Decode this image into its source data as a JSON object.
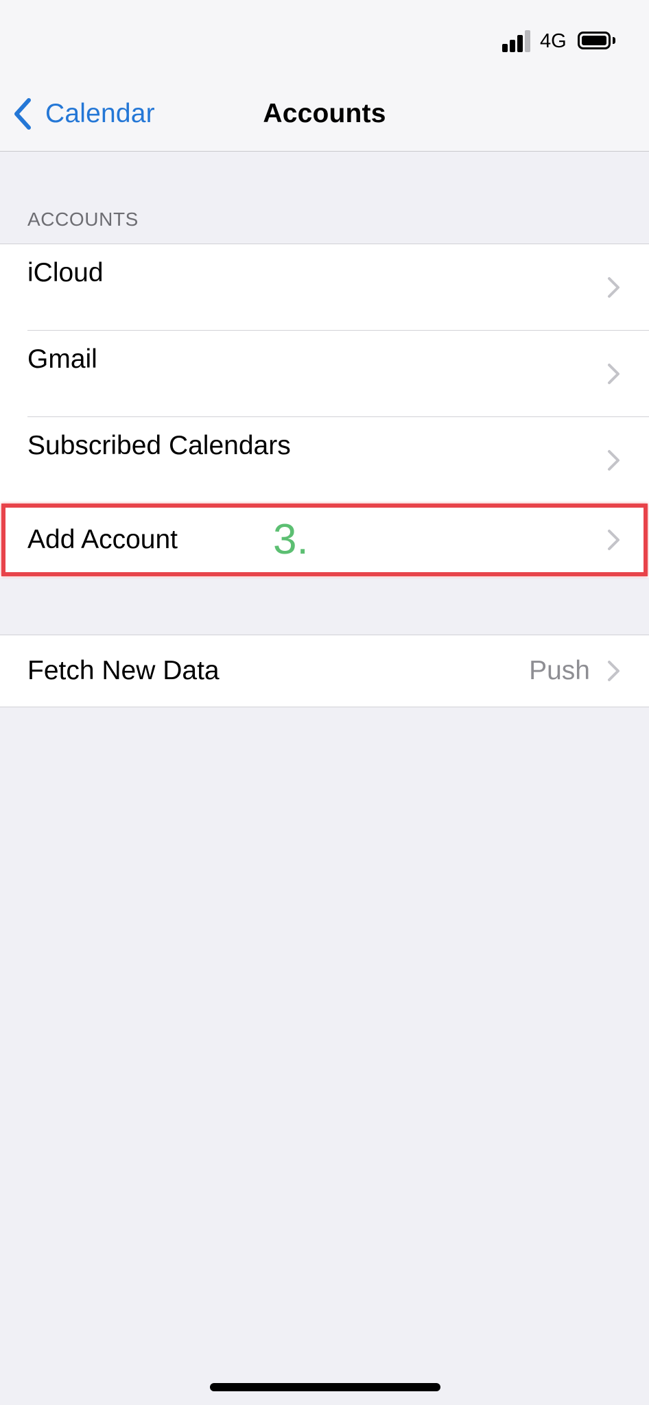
{
  "status_bar": {
    "network": "4G",
    "icons": [
      "signal-icon",
      "battery-icon"
    ]
  },
  "nav": {
    "back_label": "Calendar",
    "title": "Accounts",
    "back_icon": "chevron-left-icon",
    "accent_color": "#2477d6"
  },
  "accounts_section": {
    "header": "ACCOUNTS",
    "items": [
      {
        "label": "iCloud"
      },
      {
        "label": "Gmail"
      },
      {
        "label": "Subscribed Calendars"
      }
    ]
  },
  "add_account": {
    "label": "Add Account",
    "annotation": "3.",
    "annotation_color": "#5cbf72",
    "highlight_color": "#e8434a"
  },
  "fetch": {
    "label": "Fetch New Data",
    "value": "Push"
  }
}
